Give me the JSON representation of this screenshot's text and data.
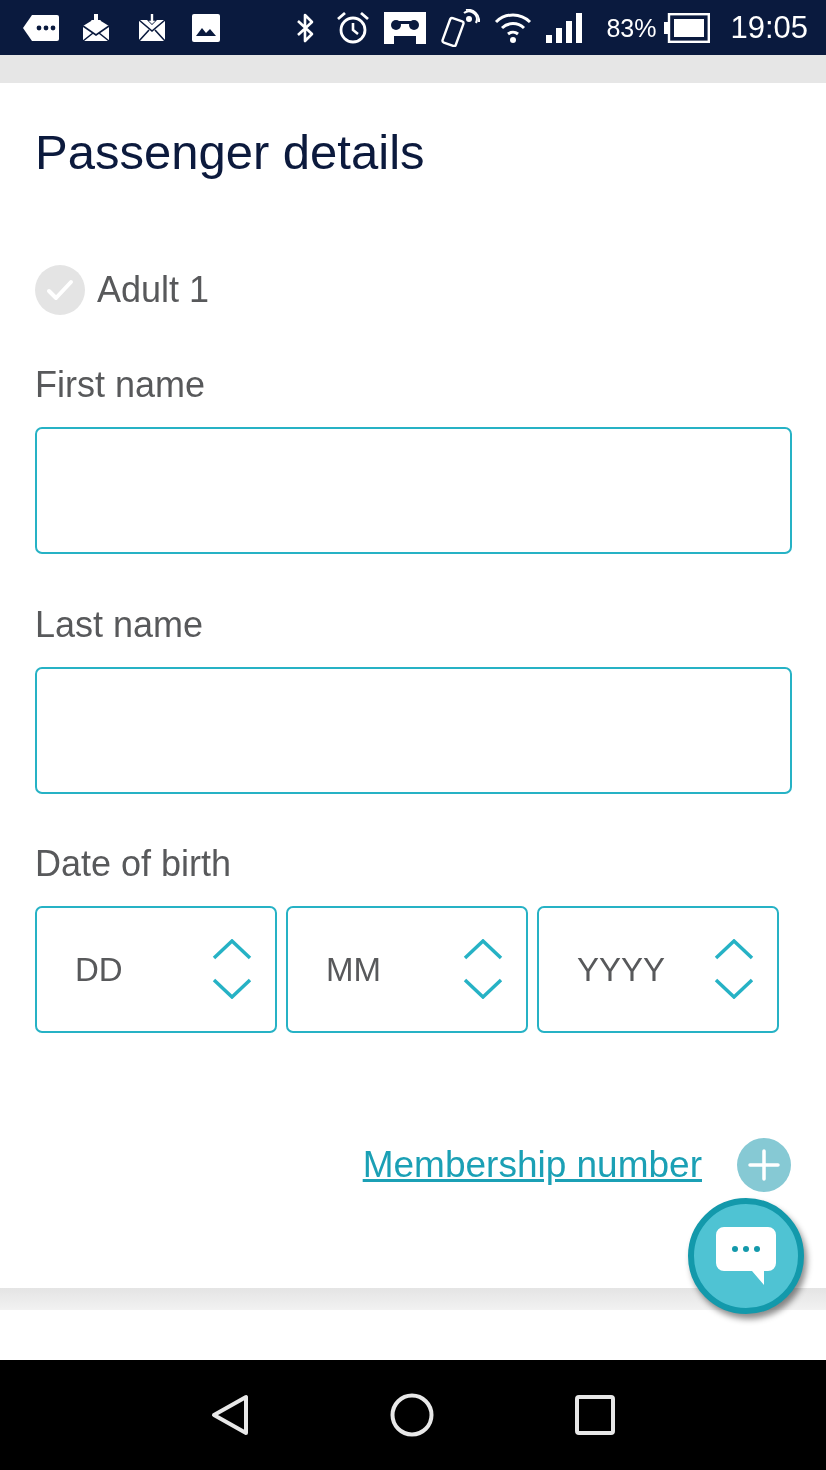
{
  "status_bar": {
    "battery_percent": "83%",
    "time": "19:05"
  },
  "title": "Passenger details",
  "passenger": {
    "label": "Adult 1",
    "complete": false
  },
  "fields": [
    {
      "label": "First name"
    },
    {
      "label": "Last name"
    }
  ],
  "date_of_birth": {
    "label": "Date of birth",
    "parts": [
      {
        "placeholder": "DD"
      },
      {
        "placeholder": "MM"
      },
      {
        "placeholder": "YYYY"
      }
    ]
  },
  "membership": {
    "link": "Membership number"
  }
}
